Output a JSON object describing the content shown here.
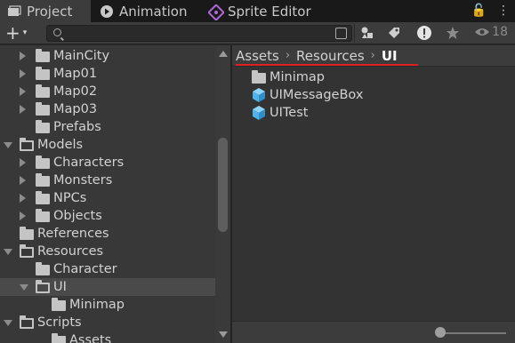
{
  "tabs": [
    {
      "label": "Project",
      "icon": "folder-stack-icon",
      "active": true
    },
    {
      "label": "Animation",
      "icon": "play-clock-icon",
      "active": false
    },
    {
      "label": "Sprite Editor",
      "icon": "sprite-editor-icon",
      "active": false
    }
  ],
  "tabbar_right": {
    "lock_glyph": "🔓",
    "menu_glyph": "⋮"
  },
  "toolbar": {
    "plus_glyph": "+",
    "caret_glyph": "▾",
    "search_value": "",
    "hidden_count": "18"
  },
  "tree": {
    "rows": [
      {
        "label": "MainCity",
        "arrow": "right",
        "open": false
      },
      {
        "label": "Map01",
        "arrow": "right",
        "open": false
      },
      {
        "label": "Map02",
        "arrow": "right",
        "open": false
      },
      {
        "label": "Map03",
        "arrow": "right",
        "open": false
      },
      {
        "label": "Prefabs",
        "arrow": "none",
        "open": false
      },
      {
        "label": "Models",
        "arrow": "down",
        "open": true
      },
      {
        "label": "Characters",
        "arrow": "right",
        "open": false
      },
      {
        "label": "Monsters",
        "arrow": "right",
        "open": false
      },
      {
        "label": "NPCs",
        "arrow": "right",
        "open": false
      },
      {
        "label": "Objects",
        "arrow": "right",
        "open": false
      },
      {
        "label": "References",
        "arrow": "none",
        "open": false
      },
      {
        "label": "Resources",
        "arrow": "down",
        "open": true
      },
      {
        "label": "Character",
        "arrow": "none",
        "open": false
      },
      {
        "label": "UI",
        "arrow": "down",
        "open": true,
        "selected": true
      },
      {
        "label": "Minimap",
        "arrow": "none",
        "open": false
      },
      {
        "label": "Scripts",
        "arrow": "down",
        "open": true
      },
      {
        "label": "Assets",
        "arrow": "none",
        "open": false
      }
    ]
  },
  "breadcrumb": {
    "items": [
      "Assets",
      "Resources",
      "UI"
    ],
    "separator": "›"
  },
  "content": {
    "items": [
      {
        "label": "Minimap",
        "type": "folder"
      },
      {
        "label": "UIMessageBox",
        "type": "prefab"
      },
      {
        "label": "UITest",
        "type": "prefab"
      }
    ]
  },
  "colors": {
    "annotation_underline": "#e02020",
    "prefab_blue": "#4fb3e8",
    "selection": "#4a4a4a"
  }
}
